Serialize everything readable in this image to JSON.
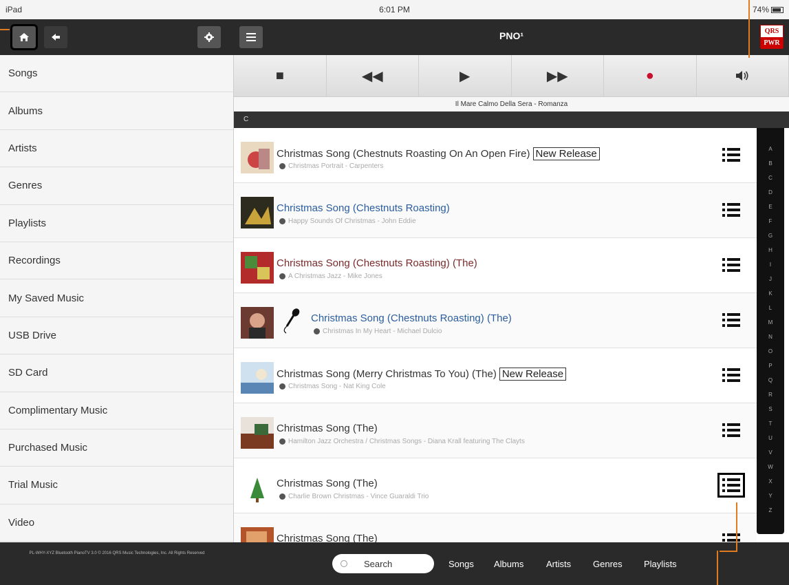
{
  "statusbar": {
    "left": "iPad",
    "time": "6:01 PM",
    "right": "74%"
  },
  "appbar": {
    "title": "PNO¹",
    "logo_top": "QRS",
    "logo_bottom": "PWR"
  },
  "sidebar": {
    "items": [
      "Songs",
      "Albums",
      "Artists",
      "Genres",
      "Playlists",
      "Recordings",
      "My Saved Music",
      "USB Drive",
      "SD Card",
      "Complimentary Music",
      "Purchased Music",
      "Trial Music",
      "Video"
    ]
  },
  "transport": {
    "now_playing": "Il Mare Calmo Della Sera - Romanza"
  },
  "section_letter": "C",
  "songs": [
    {
      "title": "Christmas Song (Chestnuts Roasting On An Open Fire)",
      "badge": "New Release",
      "sub": "Christmas Portrait - Carpenters"
    },
    {
      "title": "Christmas Song (Chestnuts Roasting)",
      "badge": "",
      "sub": "Happy Sounds Of Christmas - John Eddie"
    },
    {
      "title": "Christmas Song (Chestnuts Roasting) (The)",
      "badge": "",
      "sub": "A Christmas Jazz - Mike Jones"
    },
    {
      "title": "Christmas Song (Chestnuts Roasting) (The)",
      "badge": "",
      "sub": "Christmas In My Heart - Michael Dulcio"
    },
    {
      "title": "Christmas Song (Merry Christmas To You) (The)",
      "badge": "New Release",
      "sub": "Christmas Song - Nat King Cole"
    },
    {
      "title": "Christmas Song (The)",
      "badge": "",
      "sub": "Hamilton Jazz Orchestra / Christmas Songs - Diana Krall featuring The Clayts"
    },
    {
      "title": "Christmas Song (The)",
      "badge": "",
      "sub": "Charlie Brown Christmas - Vince Guaraldi Trio"
    },
    {
      "title": "Christmas Song (The)",
      "badge": "",
      "sub": ""
    }
  ],
  "alphabet": [
    "A",
    "B",
    "C",
    "D",
    "E",
    "F",
    "G",
    "H",
    "I",
    "J",
    "K",
    "L",
    "M",
    "N",
    "O",
    "P",
    "Q",
    "R",
    "S",
    "T",
    "U",
    "V",
    "W",
    "X",
    "Y",
    "Z"
  ],
  "footer": {
    "copyright": "PL-WHY-XYZ Bluetooth PianoTV 3.0 © 2016 QRS Music Technologies, Inc. All Rights Reserved",
    "search": "Search",
    "tabs": [
      "Songs",
      "Albums",
      "Artists",
      "Genres",
      "Playlists"
    ]
  },
  "colors": {
    "toolbar": "#2a2a2a",
    "record": "#c8102e",
    "link_blue": "#2a5d9f",
    "annotation": "#e07b1f"
  }
}
